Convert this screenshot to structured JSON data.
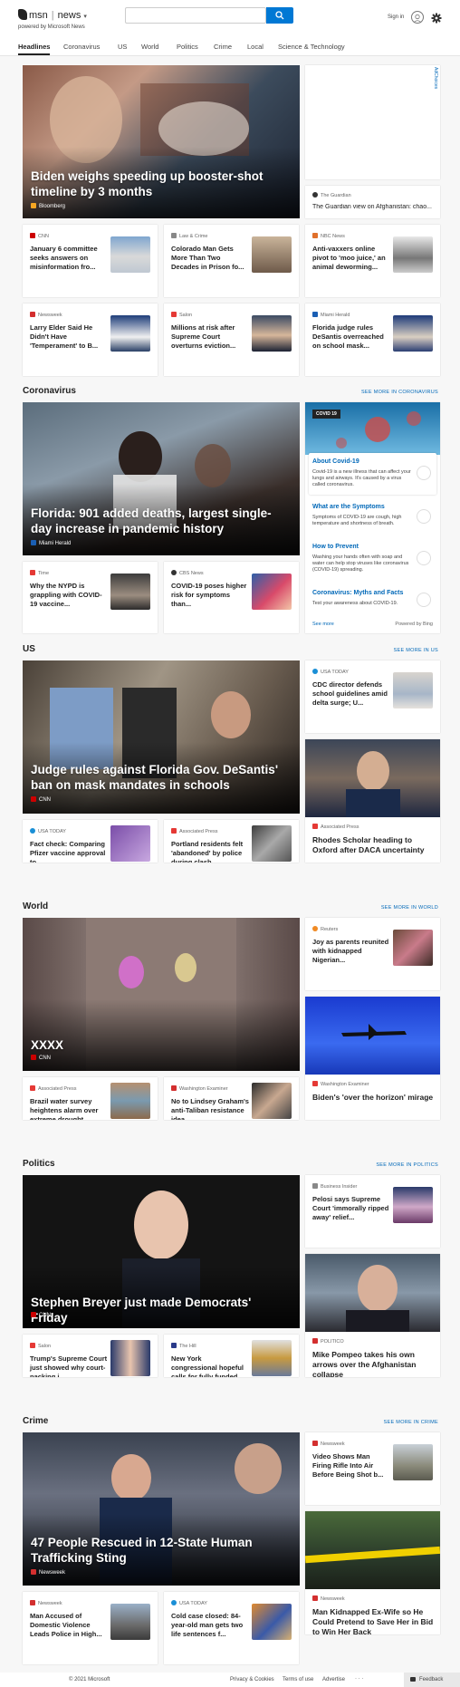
{
  "header": {
    "brand": "msn",
    "section": "news",
    "tagline": "powered by Microsoft News",
    "search_placeholder": "",
    "signin": "Sign in"
  },
  "nav": [
    "Headlines",
    "Coronavirus",
    "US",
    "World",
    "Politics",
    "Crime",
    "Local",
    "Science & Technology"
  ],
  "top": {
    "hero": {
      "title": "Biden weighs speeding up booster-shot timeline by 3 months",
      "source": "Bloomberg"
    },
    "ad_label": "AdChoices",
    "guardian": {
      "source": "The Guardian",
      "title": "The Guardian view on Afghanistan: chao..."
    },
    "cards": [
      {
        "source": "CNN",
        "title": "January 6 committee seeks answers on misinformation fro..."
      },
      {
        "source": "Law & Crime",
        "title": "Colorado Man Gets More Than Two Decades in Prison fo..."
      },
      {
        "source": "NBC News",
        "title": "Anti-vaxxers online pivot to 'moo juice,' an animal deworming..."
      },
      {
        "source": "Newsweek",
        "title": "Larry Elder Said He Didn't Have 'Temperament' to B..."
      },
      {
        "source": "Salon",
        "title": "Millions at risk after Supreme Court overturns eviction..."
      },
      {
        "source": "Miami Herald",
        "title": "Florida judge rules DeSantis overreached on school mask..."
      }
    ]
  },
  "coronavirus": {
    "title": "Coronavirus",
    "see_more": "SEE MORE IN CORONAVIRUS",
    "hero": {
      "title": "Florida: 901 added deaths, largest single-day increase in pandemic history",
      "source": "Miami Herald"
    },
    "covid_badge": "COVID 19",
    "info": [
      {
        "title": "About Covid-19",
        "text": "Covid-19 is a new illness that can affect your lungs and airways. It's caused by a virus called coronavirus."
      },
      {
        "title": "What are the Symptoms",
        "text": "Symptoms of COVID-19 are cough, high temperature and shortness of breath."
      },
      {
        "title": "How to Prevent",
        "text": "Washing your hands often with soap and water can help stop viruses like coronavirus (COVID-19) spreading."
      },
      {
        "title": "Coronavirus: Myths and Facts",
        "text": "Test your awareness about COVID-19."
      }
    ],
    "see_more_link": "See more",
    "powered": "Powered by Bing",
    "cards": [
      {
        "source": "Time",
        "title": "Why the NYPD is grappling with COVID-19 vaccine..."
      },
      {
        "source": "CBS News",
        "title": "COVID-19 poses higher risk for symptoms than..."
      }
    ]
  },
  "us": {
    "title": "US",
    "see_more": "SEE MORE IN US",
    "hero": {
      "title": "Judge rules against Florida Gov. DeSantis' ban on mask mandates in schools",
      "source": "CNN"
    },
    "side1": {
      "source": "USA TODAY",
      "title": "CDC director defends school guidelines amid delta surge; U..."
    },
    "side2": {
      "source": "Associated Press",
      "title": "Rhodes Scholar heading to Oxford after DACA uncertainty"
    },
    "cards": [
      {
        "source": "USA TODAY",
        "title": "Fact check: Comparing Pfizer vaccine approval to..."
      },
      {
        "source": "Associated Press",
        "title": "Portland residents felt 'abandoned' by police during clash"
      }
    ]
  },
  "world": {
    "title": "World",
    "see_more": "SEE MORE IN WORLD",
    "hero": {
      "title": "XXXX",
      "source": "CNN"
    },
    "side1": {
      "source": "Reuters",
      "title": "Joy as parents reunited with kidnapped Nigerian..."
    },
    "side2": {
      "source": "Washington Examiner",
      "title": "Biden's 'over the horizon' mirage"
    },
    "cards": [
      {
        "source": "Associated Press",
        "title": "Brazil water survey heightens alarm over extreme drought"
      },
      {
        "source": "Washington Examiner",
        "title": "No to Lindsey Graham's anti-Taliban resistance idea"
      }
    ]
  },
  "politics": {
    "title": "Politics",
    "see_more": "SEE MORE IN POLITICS",
    "hero": {
      "title": "Stephen Breyer just made Democrats' Friday",
      "source": "CNN"
    },
    "side1": {
      "source": "Business Insider",
      "title": "Pelosi says Supreme Court 'immorally ripped away' relief..."
    },
    "side2": {
      "source": "POLITICO",
      "title": "Mike Pompeo takes his own arrows over the Afghanistan collapse"
    },
    "cards": [
      {
        "source": "Salon",
        "title": "Trump's Supreme Court just showed why court-packing i..."
      },
      {
        "source": "The Hill",
        "title": "New York congressional hopeful calls for fully funded..."
      }
    ]
  },
  "crime": {
    "title": "Crime",
    "see_more": "SEE MORE IN CRIME",
    "hero": {
      "title": "47 People Rescued in 12-State Human Trafficking Sting",
      "source": "Newsweek"
    },
    "side1": {
      "source": "Newsweek",
      "title": "Video Shows Man Firing Rifle Into Air Before Being Shot b..."
    },
    "side2": {
      "source": "Newsweek",
      "title": "Man Kidnapped Ex-Wife so He Could Pretend to Save Her in Bid to Win Her Back"
    },
    "cards": [
      {
        "source": "Newsweek",
        "title": "Man Accused of Domestic Violence Leads Police in High..."
      },
      {
        "source": "USA TODAY",
        "title": "Cold case closed: 84-year-old man gets two life sentences f..."
      }
    ]
  },
  "footer": {
    "copyright": "© 2021 Microsoft",
    "privacy": "Privacy & Cookies",
    "terms": "Terms of use",
    "advertise": "Advertise",
    "more": "· · ·",
    "feedback": "Feedback"
  },
  "colors": {
    "accent": "#0078d4",
    "link": "#0068b8",
    "cnn": "#cc0000",
    "newsweek": "#d32f2f"
  }
}
